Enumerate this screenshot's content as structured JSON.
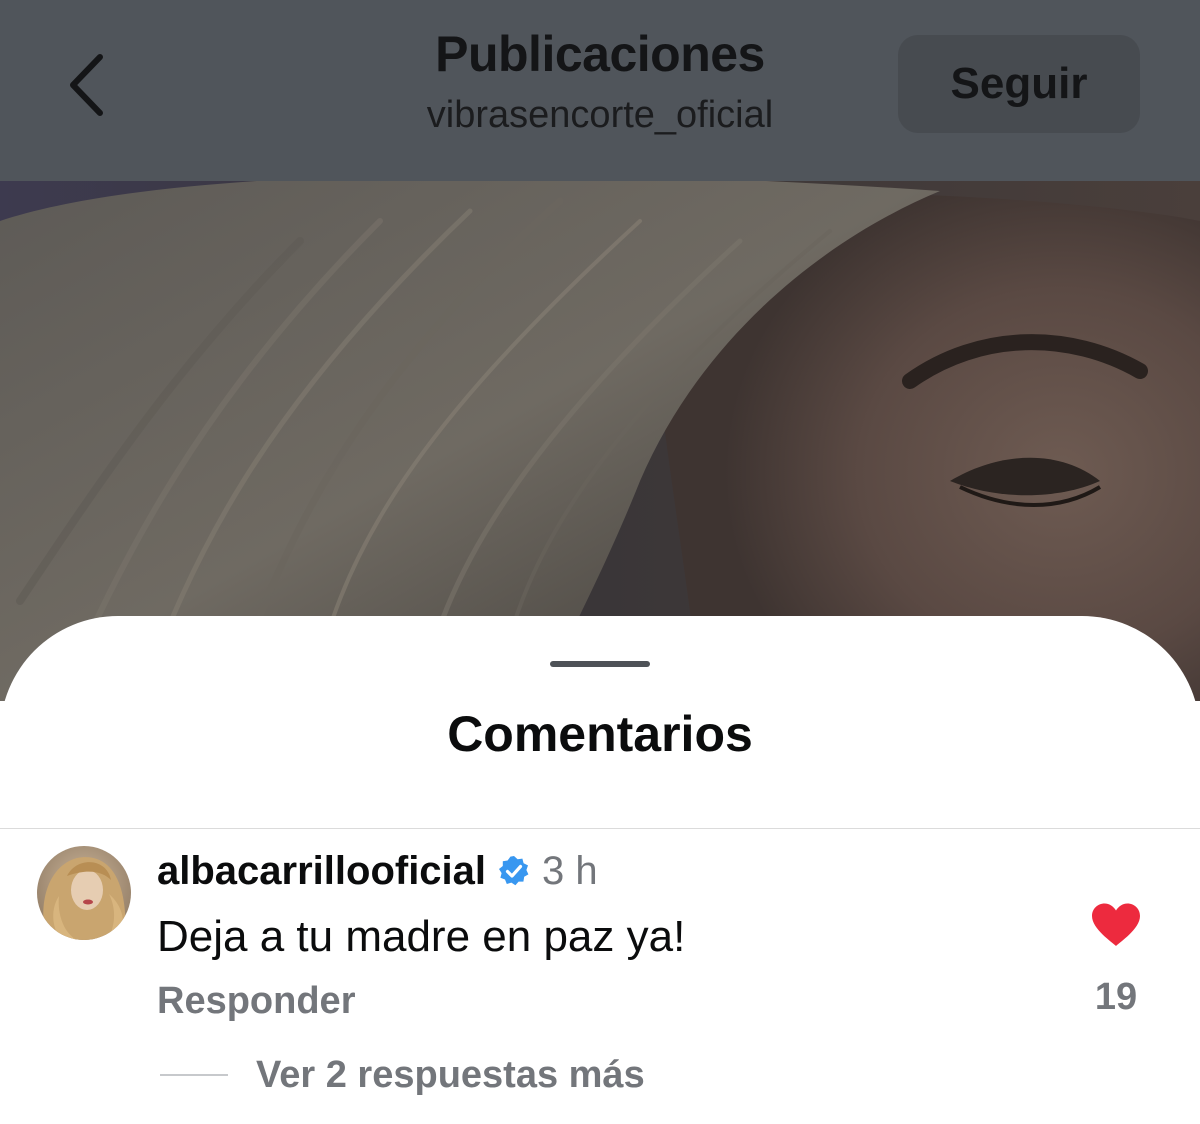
{
  "header": {
    "title": "Publicaciones",
    "subtitle": "vibrasencorte_oficial",
    "follow_label": "Seguir",
    "back_icon": "chevron-left-icon"
  },
  "post": {
    "image": "post-photo"
  },
  "comments_sheet": {
    "title": "Comentarios",
    "comments": [
      {
        "username": "albacarrillooficial",
        "verified": true,
        "timestamp": "3 h",
        "text": "Deja a tu madre en paz ya!",
        "reply_label": "Responder",
        "liked": true,
        "likes": "19",
        "view_replies_label": "Ver 2 respuestas más"
      }
    ]
  },
  "colors": {
    "header_bg": "#50555b",
    "follow_button_bg": "#474b50",
    "like_red": "#ed2a3e",
    "verified_blue": "#3897f0",
    "secondary_text": "#73767b"
  }
}
